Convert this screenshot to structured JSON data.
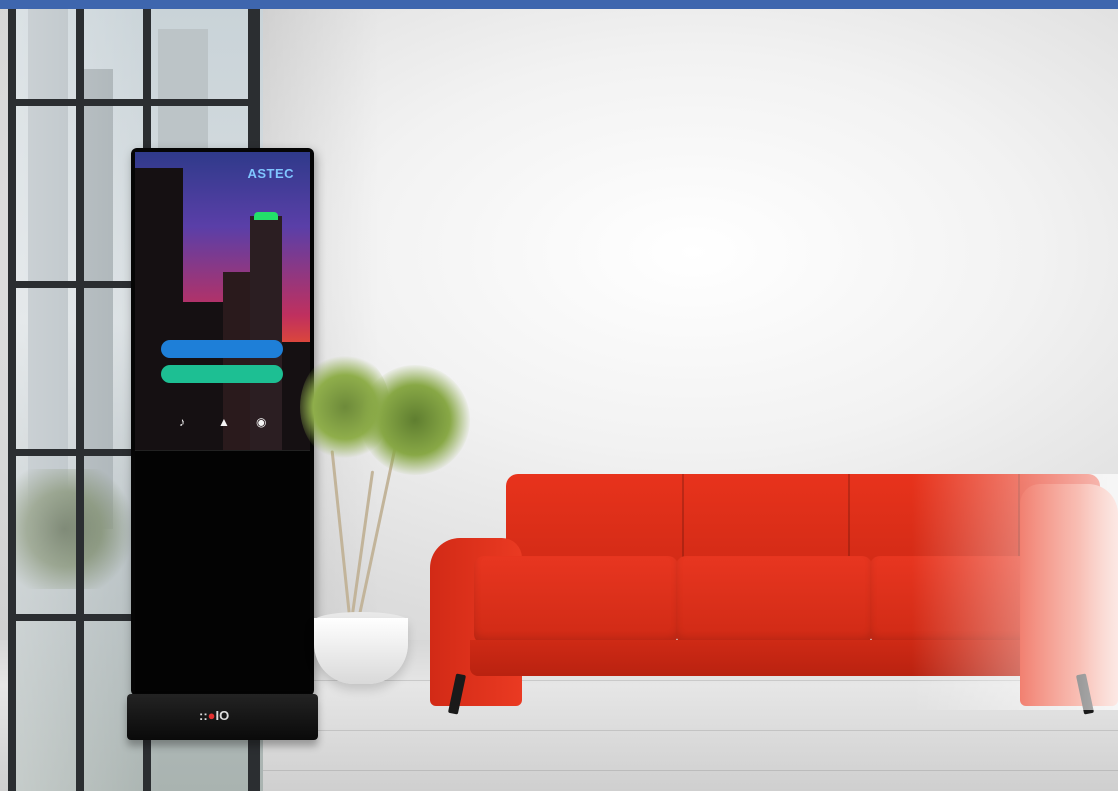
{
  "colors": {
    "top_bar": "#3e66ae",
    "kiosk_button_blue": "#1e7fd8",
    "kiosk_button_green": "#1dbf93",
    "sofa_red": "#e3321c"
  },
  "kiosk": {
    "screen_logo": "ASTEC",
    "base_logo_prefix": "::",
    "base_logo_dot": "●",
    "base_logo_suffix": "IO"
  },
  "icons": {
    "kiosk_icon_1": "♪",
    "kiosk_icon_2": "▲",
    "kiosk_icon_3": "◉"
  }
}
